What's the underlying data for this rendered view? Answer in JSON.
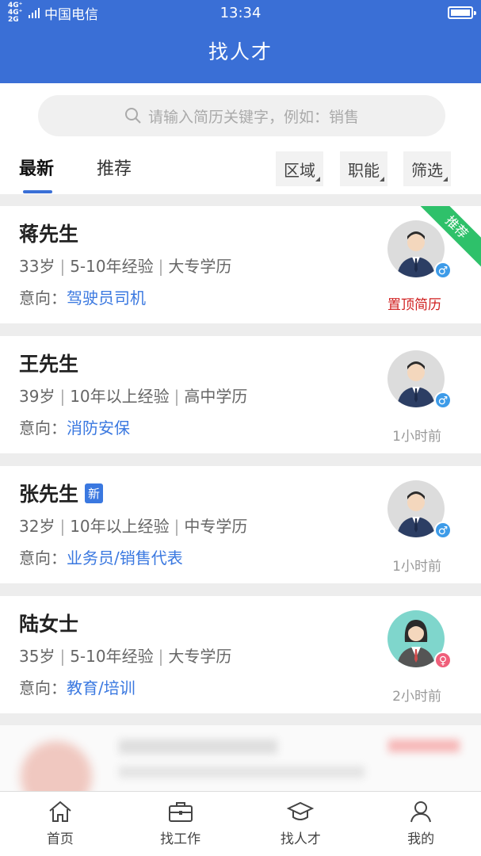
{
  "status_bar": {
    "network": "4G⁺ 4G⁺ 2G",
    "carrier": "中国电信",
    "time": "13:34"
  },
  "header": {
    "title": "找人才"
  },
  "search": {
    "placeholder": "请输入简历关键字，例如：销售"
  },
  "tabs": [
    {
      "label": "最新",
      "active": true
    },
    {
      "label": "推荐",
      "active": false
    }
  ],
  "filters": [
    {
      "label": "区域"
    },
    {
      "label": "职能"
    },
    {
      "label": "筛选"
    }
  ],
  "candidates": [
    {
      "name": "蒋先生",
      "age": "33岁",
      "experience": "5-10年经验",
      "education": "大专学历",
      "intent_label": "意向：",
      "intent": "驾驶员司机",
      "gender": "male",
      "gender_symbol": "♂",
      "ribbon": "推荐",
      "pinned": "置顶简历"
    },
    {
      "name": "王先生",
      "age": "39岁",
      "experience": "10年以上经验",
      "education": "高中学历",
      "intent_label": "意向：",
      "intent": "消防安保",
      "gender": "male",
      "gender_symbol": "♂",
      "time": "1小时前"
    },
    {
      "name": "张先生",
      "badge": "新",
      "age": "32岁",
      "experience": "10年以上经验",
      "education": "中专学历",
      "intent_label": "意向：",
      "intent": "业务员/销售代表",
      "gender": "male",
      "gender_symbol": "♂",
      "time": "1小时前"
    },
    {
      "name": "陆女士",
      "age": "35岁",
      "experience": "5-10年经验",
      "education": "大专学历",
      "intent_label": "意向：",
      "intent": "教育/培训",
      "gender": "female",
      "gender_symbol": "♀",
      "time": "2小时前"
    }
  ],
  "bottom_nav": [
    {
      "label": "首页",
      "icon": "home-icon"
    },
    {
      "label": "找工作",
      "icon": "briefcase-icon"
    },
    {
      "label": "找人才",
      "icon": "graduation-cap-icon"
    },
    {
      "label": "我的",
      "icon": "person-icon"
    }
  ],
  "colors": {
    "primary": "#3a6fd6",
    "link": "#3a78e0",
    "ribbon": "#2ec16a",
    "pinned": "#d02020",
    "male": "#3d9be8",
    "female": "#ef5f7a"
  }
}
